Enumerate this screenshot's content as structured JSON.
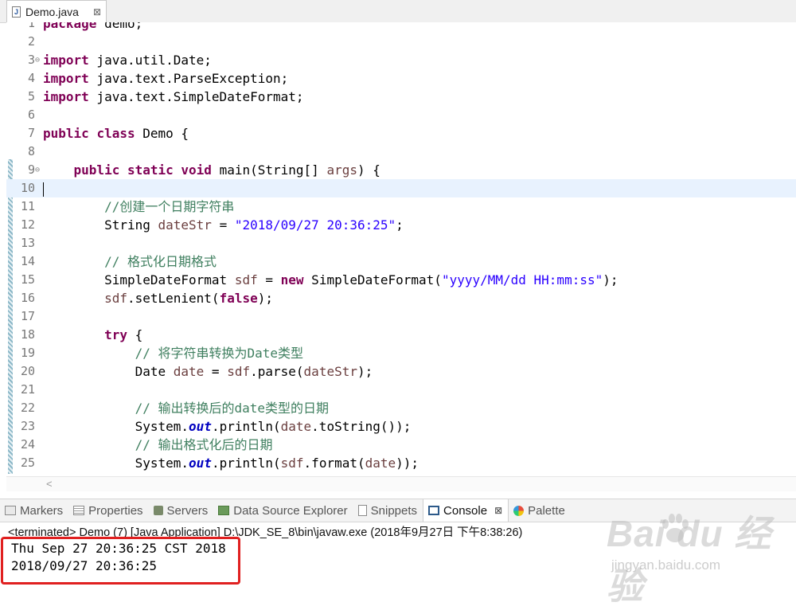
{
  "editor": {
    "tab_label": "Demo.java",
    "tab_close": "⊠",
    "file_icon_letter": "J",
    "lines": [
      {
        "n": "1",
        "fold": false,
        "current": false,
        "tokens": [
          {
            "t": "package",
            "c": "kw"
          },
          {
            "t": " demo;"
          }
        ]
      },
      {
        "n": "2",
        "fold": false,
        "current": false,
        "tokens": []
      },
      {
        "n": "3",
        "fold": true,
        "current": false,
        "tokens": [
          {
            "t": "import",
            "c": "kw"
          },
          {
            "t": " java.util.Date;"
          }
        ]
      },
      {
        "n": "4",
        "fold": false,
        "current": false,
        "tokens": [
          {
            "t": "import",
            "c": "kw"
          },
          {
            "t": " java.text.ParseException;"
          }
        ]
      },
      {
        "n": "5",
        "fold": false,
        "current": false,
        "tokens": [
          {
            "t": "import",
            "c": "kw"
          },
          {
            "t": " java.text.SimpleDateFormat;"
          }
        ]
      },
      {
        "n": "6",
        "fold": false,
        "current": false,
        "tokens": []
      },
      {
        "n": "7",
        "fold": false,
        "current": false,
        "tokens": [
          {
            "t": "public",
            "c": "kw"
          },
          {
            "t": " "
          },
          {
            "t": "class",
            "c": "kw"
          },
          {
            "t": " Demo {"
          }
        ]
      },
      {
        "n": "8",
        "fold": false,
        "current": false,
        "tokens": []
      },
      {
        "n": "9",
        "fold": true,
        "current": false,
        "tokens": [
          {
            "t": "    "
          },
          {
            "t": "public",
            "c": "kw"
          },
          {
            "t": " "
          },
          {
            "t": "static",
            "c": "kw"
          },
          {
            "t": " "
          },
          {
            "t": "void",
            "c": "kw"
          },
          {
            "t": " main(String[] "
          },
          {
            "t": "args",
            "c": "var"
          },
          {
            "t": ") {"
          }
        ]
      },
      {
        "n": "10",
        "fold": false,
        "current": true,
        "tokens": []
      },
      {
        "n": "11",
        "fold": false,
        "current": false,
        "tokens": [
          {
            "t": "        "
          },
          {
            "t": "//创建一个日期字符串",
            "c": "cmt"
          }
        ]
      },
      {
        "n": "12",
        "fold": false,
        "current": false,
        "tokens": [
          {
            "t": "        String "
          },
          {
            "t": "dateStr",
            "c": "var"
          },
          {
            "t": " = "
          },
          {
            "t": "\"2018/09/27 20:36:25\"",
            "c": "str"
          },
          {
            "t": ";"
          }
        ]
      },
      {
        "n": "13",
        "fold": false,
        "current": false,
        "tokens": []
      },
      {
        "n": "14",
        "fold": false,
        "current": false,
        "tokens": [
          {
            "t": "        "
          },
          {
            "t": "// 格式化日期格式",
            "c": "cmt"
          }
        ]
      },
      {
        "n": "15",
        "fold": false,
        "current": false,
        "tokens": [
          {
            "t": "        SimpleDateFormat "
          },
          {
            "t": "sdf",
            "c": "var"
          },
          {
            "t": " = "
          },
          {
            "t": "new",
            "c": "kw"
          },
          {
            "t": " SimpleDateFormat("
          },
          {
            "t": "\"yyyy/MM/dd HH:mm:ss\"",
            "c": "str"
          },
          {
            "t": ");"
          }
        ]
      },
      {
        "n": "16",
        "fold": false,
        "current": false,
        "tokens": [
          {
            "t": "        "
          },
          {
            "t": "sdf",
            "c": "var"
          },
          {
            "t": ".setLenient("
          },
          {
            "t": "false",
            "c": "kw"
          },
          {
            "t": ");"
          }
        ]
      },
      {
        "n": "17",
        "fold": false,
        "current": false,
        "tokens": []
      },
      {
        "n": "18",
        "fold": false,
        "current": false,
        "tokens": [
          {
            "t": "        "
          },
          {
            "t": "try",
            "c": "kw"
          },
          {
            "t": " {"
          }
        ]
      },
      {
        "n": "19",
        "fold": false,
        "current": false,
        "tokens": [
          {
            "t": "            "
          },
          {
            "t": "// 将字符串转换为Date类型",
            "c": "cmt"
          }
        ]
      },
      {
        "n": "20",
        "fold": false,
        "current": false,
        "tokens": [
          {
            "t": "            Date "
          },
          {
            "t": "date",
            "c": "var"
          },
          {
            "t": " = "
          },
          {
            "t": "sdf",
            "c": "var"
          },
          {
            "t": ".parse("
          },
          {
            "t": "dateStr",
            "c": "var"
          },
          {
            "t": ");"
          }
        ]
      },
      {
        "n": "21",
        "fold": false,
        "current": false,
        "tokens": []
      },
      {
        "n": "22",
        "fold": false,
        "current": false,
        "tokens": [
          {
            "t": "            "
          },
          {
            "t": "// 输出转换后的date类型的日期",
            "c": "cmt"
          }
        ]
      },
      {
        "n": "23",
        "fold": false,
        "current": false,
        "tokens": [
          {
            "t": "            System."
          },
          {
            "t": "out",
            "c": "fld"
          },
          {
            "t": ".println("
          },
          {
            "t": "date",
            "c": "var"
          },
          {
            "t": ".toString());"
          }
        ]
      },
      {
        "n": "24",
        "fold": false,
        "current": false,
        "tokens": [
          {
            "t": "            "
          },
          {
            "t": "// 输出格式化后的日期",
            "c": "cmt"
          }
        ]
      },
      {
        "n": "25",
        "fold": false,
        "current": false,
        "tokens": [
          {
            "t": "            System."
          },
          {
            "t": "out",
            "c": "fld"
          },
          {
            "t": ".println("
          },
          {
            "t": "sdf",
            "c": "var"
          },
          {
            "t": ".format("
          },
          {
            "t": "date",
            "c": "var"
          },
          {
            "t": "));"
          }
        ]
      }
    ]
  },
  "views": {
    "tabs": [
      {
        "label": "Markers",
        "icon": "markers-icon",
        "active": false
      },
      {
        "label": "Properties",
        "icon": "properties-icon",
        "active": false
      },
      {
        "label": "Servers",
        "icon": "servers-icon",
        "active": false
      },
      {
        "label": "Data Source Explorer",
        "icon": "data-source-icon",
        "active": false
      },
      {
        "label": "Snippets",
        "icon": "snippets-icon",
        "active": false
      },
      {
        "label": "Console",
        "icon": "console-icon",
        "active": true
      },
      {
        "label": "Palette",
        "icon": "palette-icon",
        "active": false
      }
    ],
    "console_close": "⊠"
  },
  "console": {
    "status": "<terminated> Demo (7) [Java Application] D:\\JDK_SE_8\\bin\\javaw.exe (2018年9月27日 下午8:38:26)",
    "output_line1": "Thu Sep 27 20:36:25 CST 2018",
    "output_line2": "2018/09/27 20:36:25"
  },
  "watermark": {
    "brand": "Bai du 经验",
    "site": "jingyan.baidu.com"
  },
  "colors": {
    "keyword": "#7f0055",
    "string": "#2a00ff",
    "comment": "#3f7f5f",
    "highlight_box": "#e02020"
  }
}
